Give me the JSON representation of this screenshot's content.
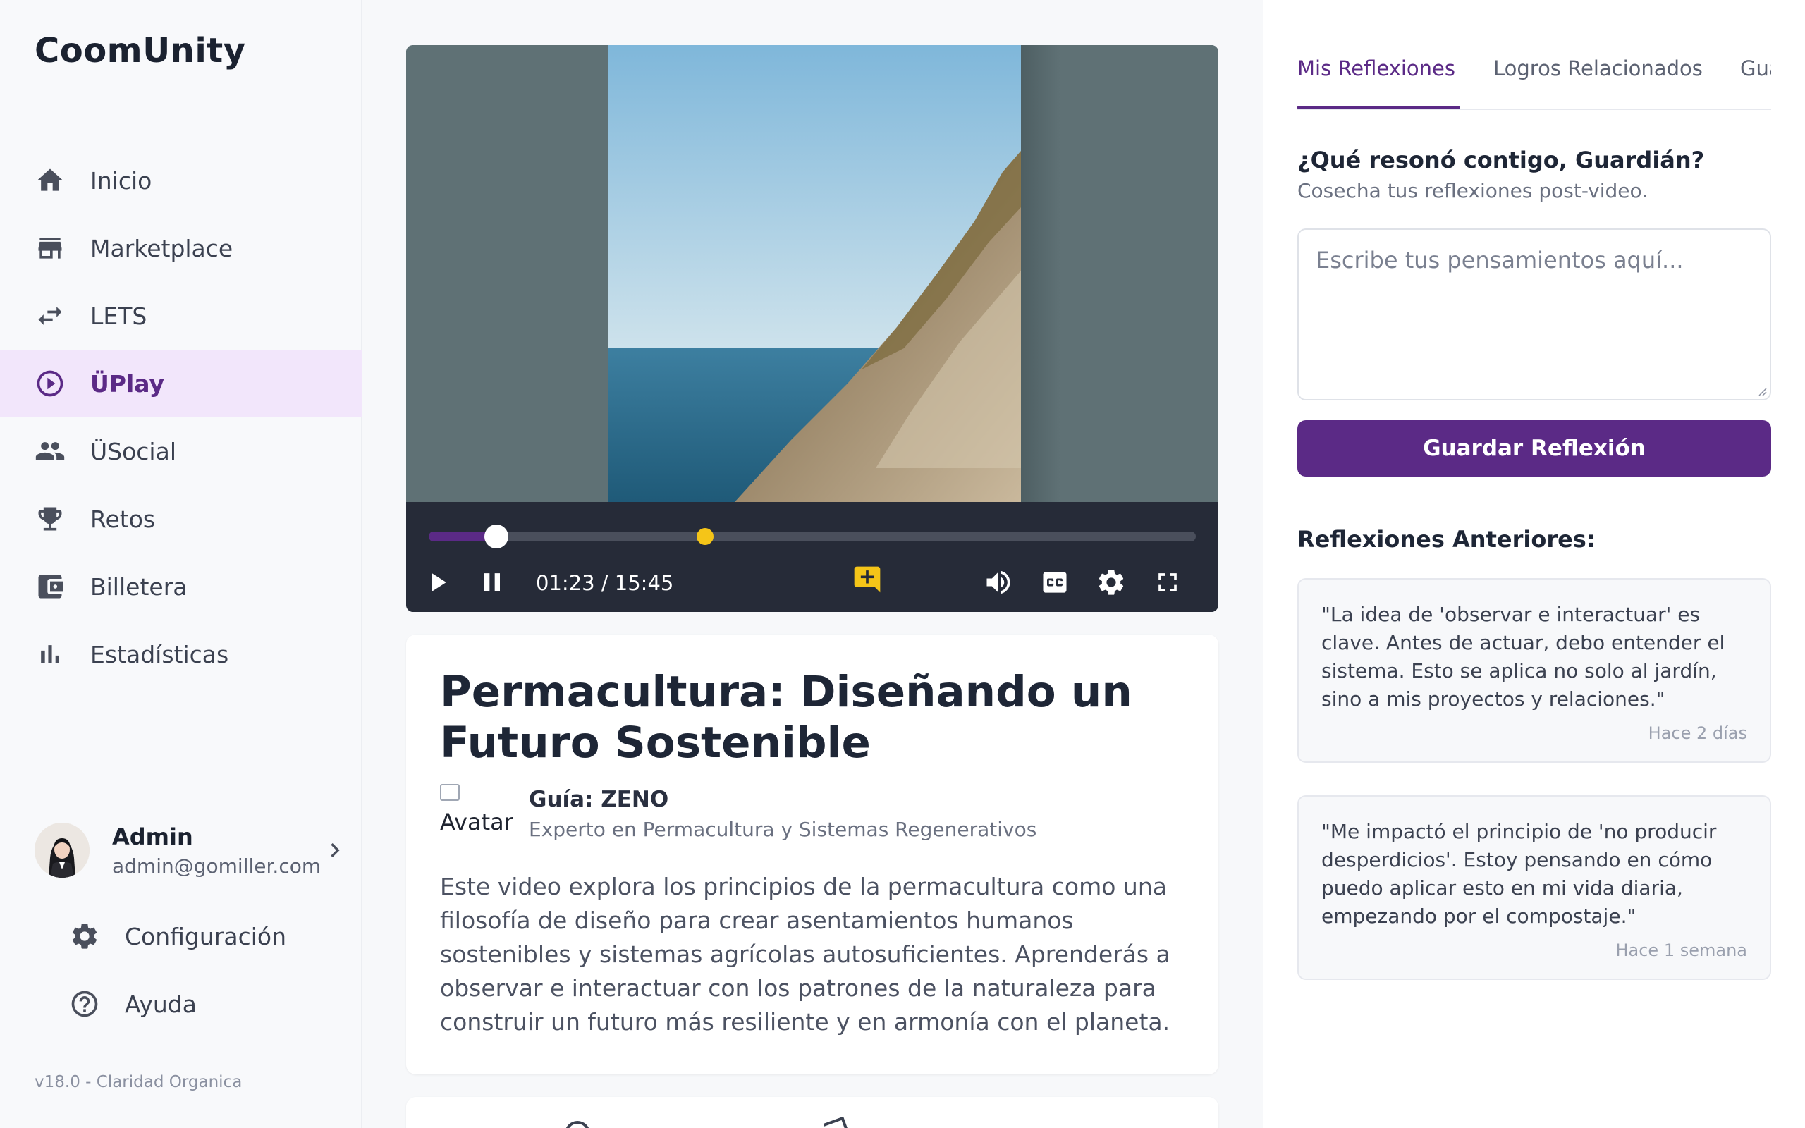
{
  "app": {
    "brand": "CoomUnity",
    "version": "v18.0 - Claridad Organica"
  },
  "sidebar": {
    "items": [
      {
        "label": "Inicio",
        "icon": "home-icon"
      },
      {
        "label": "Marketplace",
        "icon": "store-icon"
      },
      {
        "label": "LETS",
        "icon": "swap-icon"
      },
      {
        "label": "ÜPlay",
        "icon": "play-circle-icon",
        "active": true
      },
      {
        "label": "ÜSocial",
        "icon": "people-icon"
      },
      {
        "label": "Retos",
        "icon": "trophy-icon"
      },
      {
        "label": "Billetera",
        "icon": "wallet-icon"
      },
      {
        "label": "Estadísticas",
        "icon": "bar-chart-icon"
      }
    ],
    "user": {
      "name": "Admin",
      "email": "admin@gomiller.com"
    },
    "bottom_items": [
      {
        "label": "Configuración",
        "icon": "gear-icon"
      },
      {
        "label": "Ayuda",
        "icon": "help-icon"
      }
    ]
  },
  "player": {
    "current_time": "01:23",
    "duration": "15:45",
    "time_display": "01:23 / 15:45",
    "progress_fraction": 0.088,
    "marker_fraction": 0.36,
    "colors": {
      "accent": "#5b2a86",
      "marker": "#f5c518",
      "controls_bg": "#262b38"
    }
  },
  "video": {
    "title": "Permacultura: Diseñando un Futuro Sostenible",
    "guide_avatar_alt": "Avatar",
    "guide_name": "Guía: ZENO",
    "guide_role": "Experto en Permacultura y Sistemas Regenerativos",
    "description": "Este video explora los principios de la permacultura como una filosofía de diseño para crear asentamientos humanos sostenibles y sistemas agrícolas autosuficientes. Aprenderás a observar e interactuar con los patrones de la naturaleza para construir un futuro más resiliente y en armonía con el planeta."
  },
  "panel": {
    "tabs": [
      "Mis Reflexiones",
      "Logros Relacionados",
      "Guardián"
    ],
    "active_tab": 0,
    "question": "¿Qué resonó contigo, Guardián?",
    "subtitle": "Cosecha tus reflexiones post-video.",
    "input_placeholder": "Escribe tus pensamientos aquí...",
    "save_label": "Guardar Reflexión",
    "previous_title": "Reflexiones Anteriores:",
    "previous": [
      {
        "quote": "\"La idea de 'observar e interactuar' es clave. Antes de actuar, debo entender el sistema. Esto se aplica no solo al jardín, sino a mis proyectos y relaciones.\"",
        "time": "Hace 2 días"
      },
      {
        "quote": "\"Me impactó el principio de 'no producir desperdicios'. Estoy pensando en cómo puedo aplicar esto en mi vida diaria, empezando por el compostaje.\"",
        "time": "Hace 1 semana"
      }
    ]
  }
}
